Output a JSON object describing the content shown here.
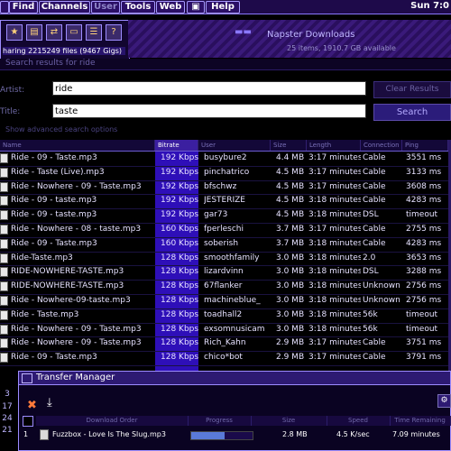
{
  "menu": {
    "items": [
      "Find",
      "Channels",
      "User",
      "Tools",
      "Web",
      "Help"
    ],
    "clock": "Sun 7:0"
  },
  "palette": {
    "tools": [
      "folder-star-icon",
      "folder-icon",
      "share-icon",
      "window-icon",
      "list-icon",
      "help-icon"
    ],
    "sharing": "haring 2215249 files (9467 Gigs)"
  },
  "header": {
    "dest_title": "Napster Downloads",
    "dest_sub": "25 items, 1910.7 GB available",
    "search_title": "Search results for ride"
  },
  "search": {
    "artist_label": "Artist:",
    "artist_value": "ride",
    "title_label": "Title:",
    "title_value": "taste",
    "clear_label": "Clear Results",
    "search_label": "Search",
    "advanced": "Show advanced search options"
  },
  "results": {
    "columns": [
      "Name",
      "Bitrate",
      "User",
      "Size",
      "Length",
      "Connection",
      "Ping"
    ],
    "rows": [
      [
        "Ride - 09 - Taste.mp3",
        "192 Kbps",
        "busybure2",
        "4.4 MB",
        "3:17 minutes",
        "Cable",
        "3551 ms"
      ],
      [
        "Ride - Taste (Live).mp3",
        "192 Kbps",
        "pinchatrico",
        "4.5 MB",
        "3:17 minutes",
        "Cable",
        "3133 ms"
      ],
      [
        "Ride - Nowhere - 09 - Taste.mp3",
        "192 Kbps",
        "bfschwz",
        "4.5 MB",
        "3:17 minutes",
        "Cable",
        "3608 ms"
      ],
      [
        "Ride - 09 - taste.mp3",
        "192 Kbps",
        "JESTERIZE",
        "4.5 MB",
        "3:18 minutes",
        "Cable",
        "4283 ms"
      ],
      [
        "Ride - 09 - taste.mp3",
        "192 Kbps",
        "gar73",
        "4.5 MB",
        "3:18 minutes",
        "DSL",
        "timeout"
      ],
      [
        "Ride - Nowhere - 08 - taste.mp3",
        "160 Kbps",
        "fperleschi",
        "3.7 MB",
        "3:17 minutes",
        "Cable",
        "2755 ms"
      ],
      [
        "Ride - 09 - Taste.mp3",
        "160 Kbps",
        "soberish",
        "3.7 MB",
        "3:18 minutes",
        "Cable",
        "4283 ms"
      ],
      [
        "Ride-Taste.mp3",
        "128 Kbps",
        "smoothfamily",
        "3.0 MB",
        "3:18 minutes",
        "2.0",
        "3653 ms"
      ],
      [
        "RIDE-NOWHERE-TASTE.mp3",
        "128 Kbps",
        "lizardvinn",
        "3.0 MB",
        "3:18 minutes",
        "DSL",
        "3288 ms"
      ],
      [
        "RIDE-NOWHERE-TASTE.mp3",
        "128 Kbps",
        "67flanker",
        "3.0 MB",
        "3:18 minutes",
        "Unknown",
        "2756 ms"
      ],
      [
        "Ride - Nowhere-09-taste.mp3",
        "128 Kbps",
        "machineblue_",
        "3.0 MB",
        "3:18 minutes",
        "Unknown",
        "2756 ms"
      ],
      [
        "Ride - Taste.mp3",
        "128 Kbps",
        "toadhall2",
        "3.0 MB",
        "3:18 minutes",
        "56k",
        "timeout"
      ],
      [
        "Ride - Nowhere - 09 - Taste.mp3",
        "128 Kbps",
        "exsomnusicam",
        "3.0 MB",
        "3:18 minutes",
        "56k",
        "timeout"
      ],
      [
        "Ride - Nowhere - 09 - Taste.mp3",
        "128 Kbps",
        "Rich_Kahn",
        "2.9 MB",
        "3:17 minutes",
        "Cable",
        "3751 ms"
      ],
      [
        "Ride - 09 - Taste.mp3",
        "128 Kbps",
        "chico*bot",
        "2.9 MB",
        "3:17 minutes",
        "Cable",
        "3791 ms"
      ]
    ]
  },
  "transfer": {
    "title": "Transfer Manager",
    "columns": [
      "Download Order",
      "Progress",
      "Size",
      "Speed",
      "Time Remaining"
    ],
    "row": {
      "order": "1",
      "name": "Fuzzbox - Love Is The Slug.mp3",
      "progress": 0.55,
      "size": "2.8 MB",
      "speed": "4.5 K/sec",
      "remaining": "7.09 minutes"
    },
    "side_numbers": [
      "3",
      "17",
      "24",
      "21"
    ]
  }
}
